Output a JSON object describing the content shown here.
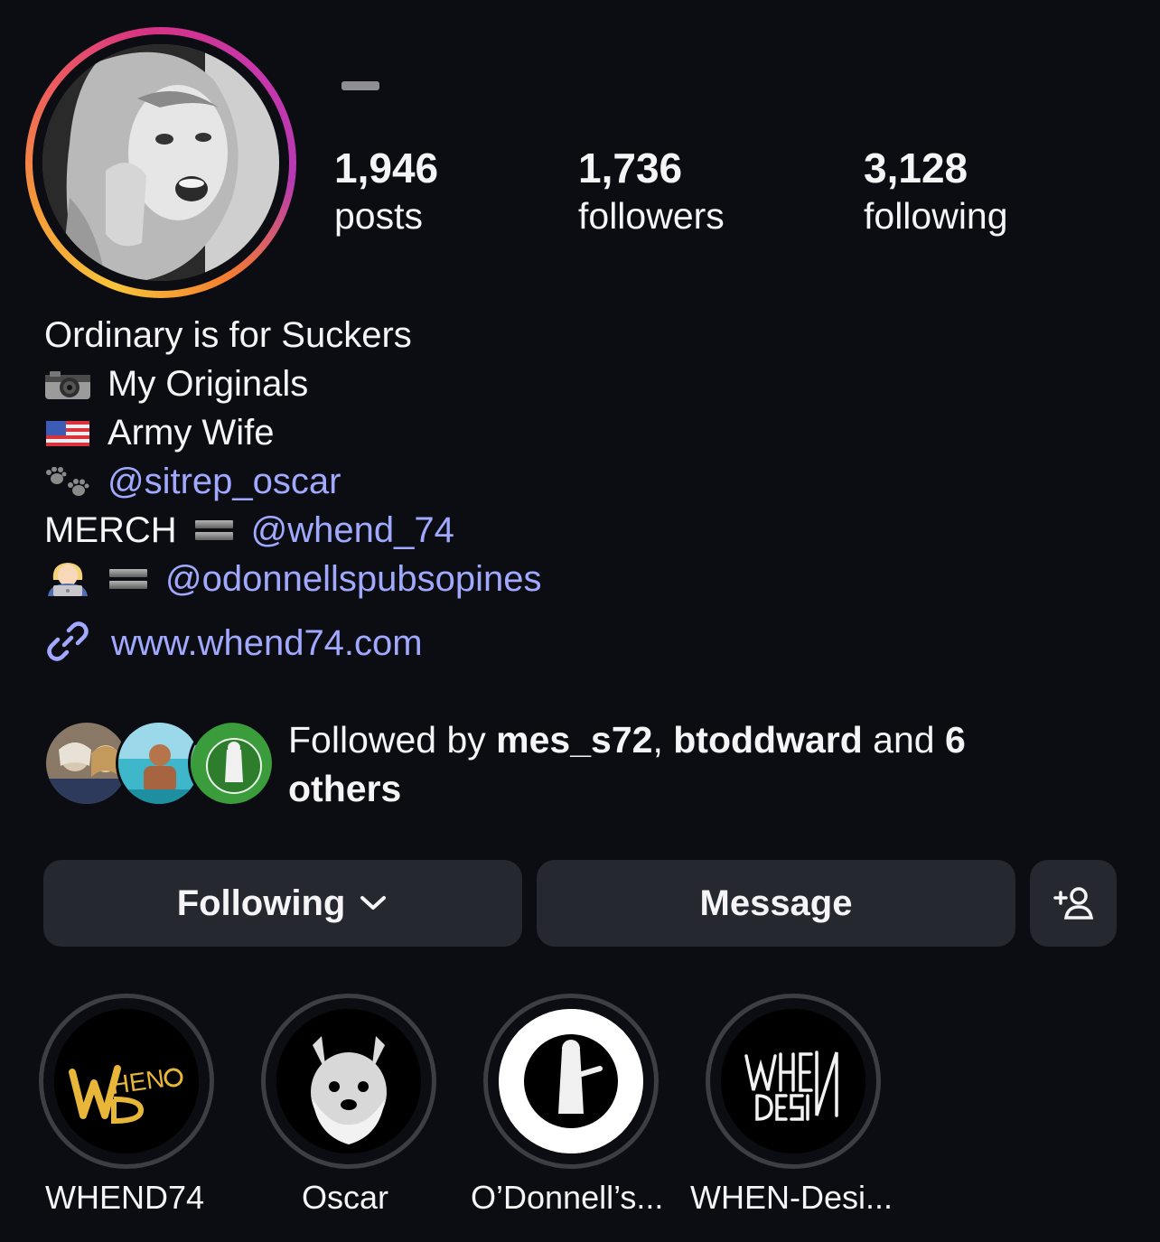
{
  "profile": {
    "avatar_icon": "profile-photo",
    "stats": {
      "posts": {
        "value": "1,946",
        "label": "posts"
      },
      "followers": {
        "value": "1,736",
        "label": "followers"
      },
      "following": {
        "value": "3,128",
        "label": "following"
      }
    }
  },
  "bio": {
    "line1": "Ordinary is for Suckers",
    "line2": {
      "icon": "camera-emoji",
      "text": "My Originals"
    },
    "line3": {
      "icon": "us-flag-emoji",
      "text": "Army Wife"
    },
    "line4": {
      "icon": "paw-prints-emoji",
      "link": "@sitrep_oscar"
    },
    "line5": {
      "text": "MERCH",
      "icon": "equals-emoji",
      "link": "@whend_74"
    },
    "line6": {
      "icon": "woman-laptop-emoji",
      "icon2": "equals-emoji",
      "link": "@odonnellspubsopines"
    },
    "website": {
      "icon": "link-icon",
      "text": "www.whend74.com"
    }
  },
  "followed_by": {
    "prefix": "Followed by ",
    "user1": "mes_s72",
    "sep": ", ",
    "user2": "btoddward",
    "and": " and ",
    "count": "6",
    "others": "others"
  },
  "buttons": {
    "following": "Following",
    "message": "Message",
    "add_user_icon": "add-user-icon"
  },
  "highlights": [
    {
      "label": "WHEND74"
    },
    {
      "label": "Oscar"
    },
    {
      "label": "O’Donnell’s..."
    },
    {
      "label": "WHEN-Desi..."
    }
  ],
  "colors": {
    "background": "#0c0d12",
    "link": "#a1a9ff",
    "button": "#25282e"
  }
}
